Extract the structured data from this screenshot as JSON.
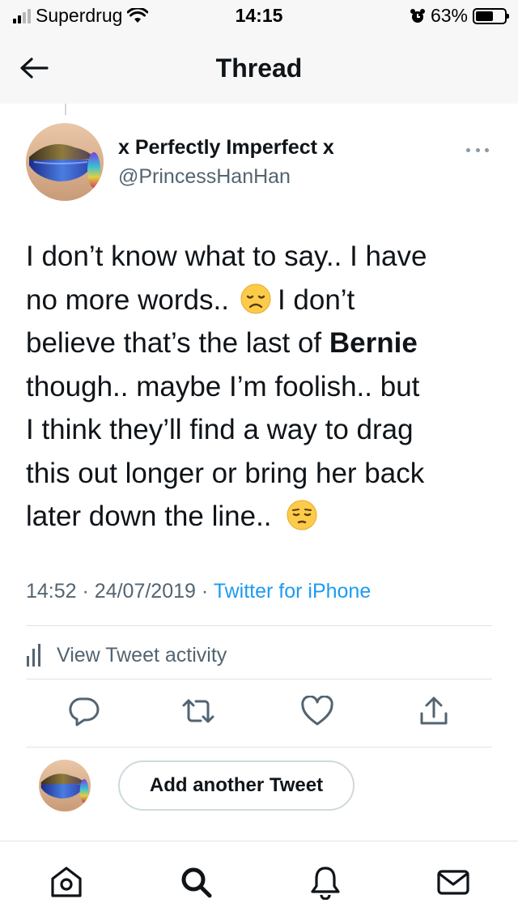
{
  "status_bar": {
    "carrier": "Superdrug",
    "time": "14:15",
    "battery_percent": "63%",
    "battery_level": 0.63,
    "signal_bars": 2,
    "signal_total": 4
  },
  "header": {
    "title": "Thread",
    "back_icon": "arrow-left-icon"
  },
  "tweet": {
    "author_name": "x Perfectly Imperfect x",
    "author_handle": "@PrincessHanHan",
    "lines": [
      {
        "before": "I don’t know what to say.. I have",
        "bold": "",
        "after": ""
      },
      {
        "before": "no more words..",
        "emoji": "disappointed-face-emoji",
        "after": "I don’t"
      },
      {
        "before": "believe that’s the last of ",
        "bold": "Bernie",
        "after": ""
      },
      {
        "before": "though.. maybe I’m foolish.. but",
        "bold": "",
        "after": ""
      },
      {
        "before": "I think they’ll find a way to drag",
        "bold": "",
        "after": ""
      },
      {
        "before": "this out longer or bring her back",
        "bold": "",
        "after": ""
      },
      {
        "before": "later down the line..",
        "emoji": "pensive-face-emoji",
        "after": ""
      }
    ],
    "time": "14:52",
    "date": "24/07/2019",
    "separator": "·",
    "source": "Twitter for iPhone",
    "activity_label": "View Tweet activity"
  },
  "actions": [
    "reply-icon",
    "retweet-icon",
    "like-icon",
    "share-icon"
  ],
  "compose": {
    "button_label": "Add another Tweet"
  },
  "tabbar": [
    "home-icon",
    "search-icon",
    "notifications-icon",
    "messages-icon"
  ],
  "colors": {
    "link": "#1d9bf0",
    "secondary_text": "#536471",
    "border": "#cfd9de",
    "header_bg": "#f7f7f7"
  }
}
